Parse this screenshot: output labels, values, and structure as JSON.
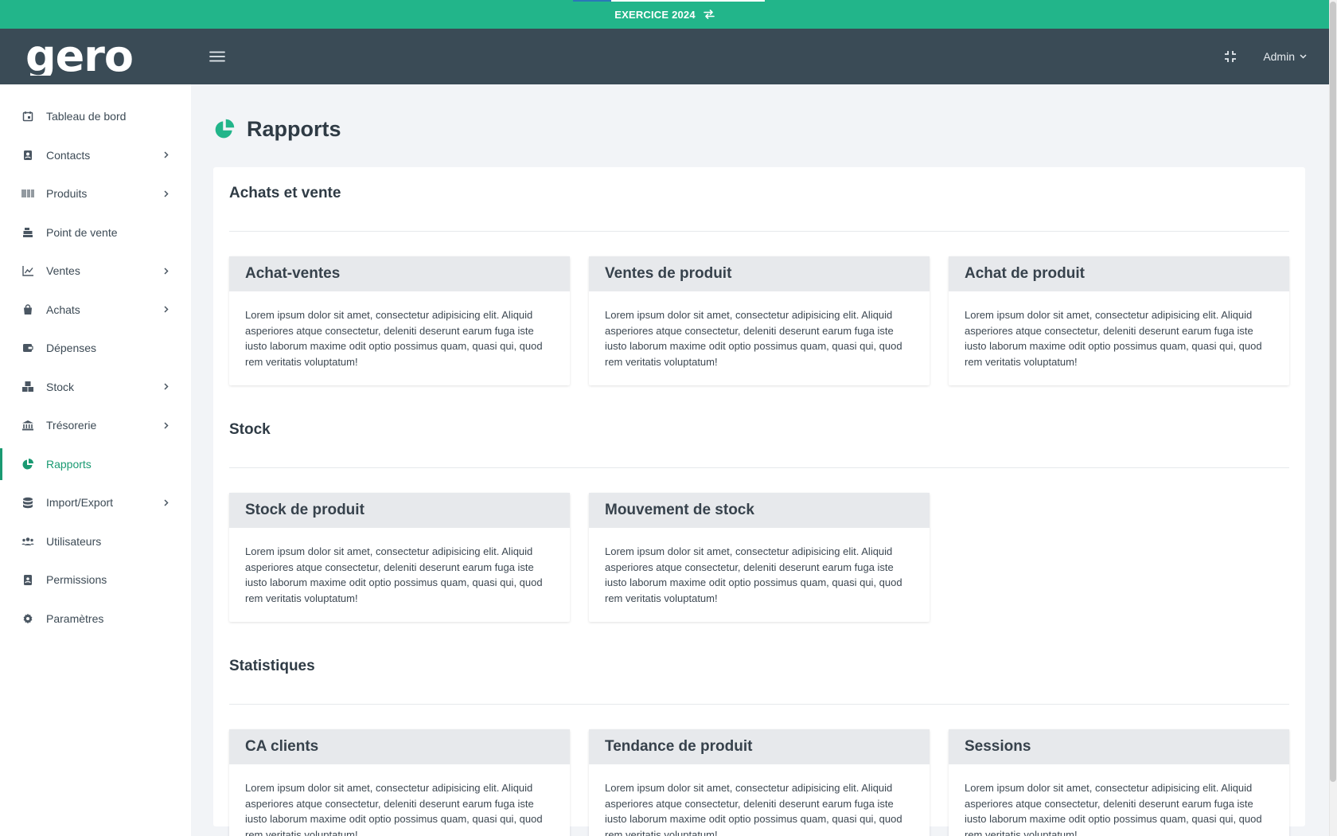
{
  "banner": {
    "label": "EXERCICE 2024"
  },
  "header": {
    "brand": "gero",
    "user": "Admin"
  },
  "sidebar": {
    "items": [
      {
        "label": "Tableau de bord",
        "icon": "calendar-icon",
        "chevron": false
      },
      {
        "label": "Contacts",
        "icon": "contacts-icon",
        "chevron": true
      },
      {
        "label": "Produits",
        "icon": "barcode-icon",
        "chevron": true
      },
      {
        "label": "Point de vente",
        "icon": "cash-register-icon",
        "chevron": false
      },
      {
        "label": "Ventes",
        "icon": "chart-line-icon",
        "chevron": true
      },
      {
        "label": "Achats",
        "icon": "shopping-bag-icon",
        "chevron": true
      },
      {
        "label": "Dépenses",
        "icon": "wallet-icon",
        "chevron": false
      },
      {
        "label": "Stock",
        "icon": "boxes-icon",
        "chevron": true
      },
      {
        "label": "Trésorerie",
        "icon": "bank-icon",
        "chevron": true
      },
      {
        "label": "Rapports",
        "icon": "pie-chart-icon",
        "chevron": false,
        "active": true
      },
      {
        "label": "Import/Export",
        "icon": "database-icon",
        "chevron": true
      },
      {
        "label": "Utilisateurs",
        "icon": "users-icon",
        "chevron": false
      },
      {
        "label": "Permissions",
        "icon": "id-badge-icon",
        "chevron": false
      },
      {
        "label": "Paramètres",
        "icon": "gear-icon",
        "chevron": false
      }
    ]
  },
  "page": {
    "title": "Rapports"
  },
  "sections": [
    {
      "title": "Achats et vente",
      "cards": [
        {
          "title": "Achat-ventes",
          "text": "Lorem ipsum dolor sit amet, consectetur adipisicing elit. Aliquid asperiores atque consectetur, deleniti deserunt earum fuga iste iusto laborum maxime odit optio possimus quam, quasi qui, quod rem veritatis voluptatum!"
        },
        {
          "title": "Ventes de produit",
          "text": "Lorem ipsum dolor sit amet, consectetur adipisicing elit. Aliquid asperiores atque consectetur, deleniti deserunt earum fuga iste iusto laborum maxime odit optio possimus quam, quasi qui, quod rem veritatis voluptatum!"
        },
        {
          "title": "Achat de produit",
          "text": "Lorem ipsum dolor sit amet, consectetur adipisicing elit. Aliquid asperiores atque consectetur, deleniti deserunt earum fuga iste iusto laborum maxime odit optio possimus quam, quasi qui, quod rem veritatis voluptatum!"
        }
      ]
    },
    {
      "title": "Stock",
      "cards": [
        {
          "title": "Stock de produit",
          "text": "Lorem ipsum dolor sit amet, consectetur adipisicing elit. Aliquid asperiores atque consectetur, deleniti deserunt earum fuga iste iusto laborum maxime odit optio possimus quam, quasi qui, quod rem veritatis voluptatum!"
        },
        {
          "title": "Mouvement de stock",
          "text": "Lorem ipsum dolor sit amet, consectetur adipisicing elit. Aliquid asperiores atque consectetur, deleniti deserunt earum fuga iste iusto laborum maxime odit optio possimus quam, quasi qui, quod rem veritatis voluptatum!"
        }
      ]
    },
    {
      "title": "Statistiques",
      "cards": [
        {
          "title": "CA clients",
          "text": "Lorem ipsum dolor sit amet, consectetur adipisicing elit. Aliquid asperiores atque consectetur, deleniti deserunt earum fuga iste iusto laborum maxime odit optio possimus quam, quasi qui, quod rem veritatis voluptatum!"
        },
        {
          "title": "Tendance de produit",
          "text": "Lorem ipsum dolor sit amet, consectetur adipisicing elit. Aliquid asperiores atque consectetur, deleniti deserunt earum fuga iste iusto laborum maxime odit optio possimus quam, quasi qui, quod rem veritatis voluptatum!"
        },
        {
          "title": "Sessions",
          "text": "Lorem ipsum dolor sit amet, consectetur adipisicing elit. Aliquid asperiores atque consectetur, deleniti deserunt earum fuga iste iusto laborum maxime odit optio possimus quam, quasi qui, quod rem veritatis voluptatum!"
        }
      ]
    }
  ],
  "colors": {
    "accent": "#22b58a",
    "header": "#3a4b56",
    "active": "#1a9a72"
  }
}
